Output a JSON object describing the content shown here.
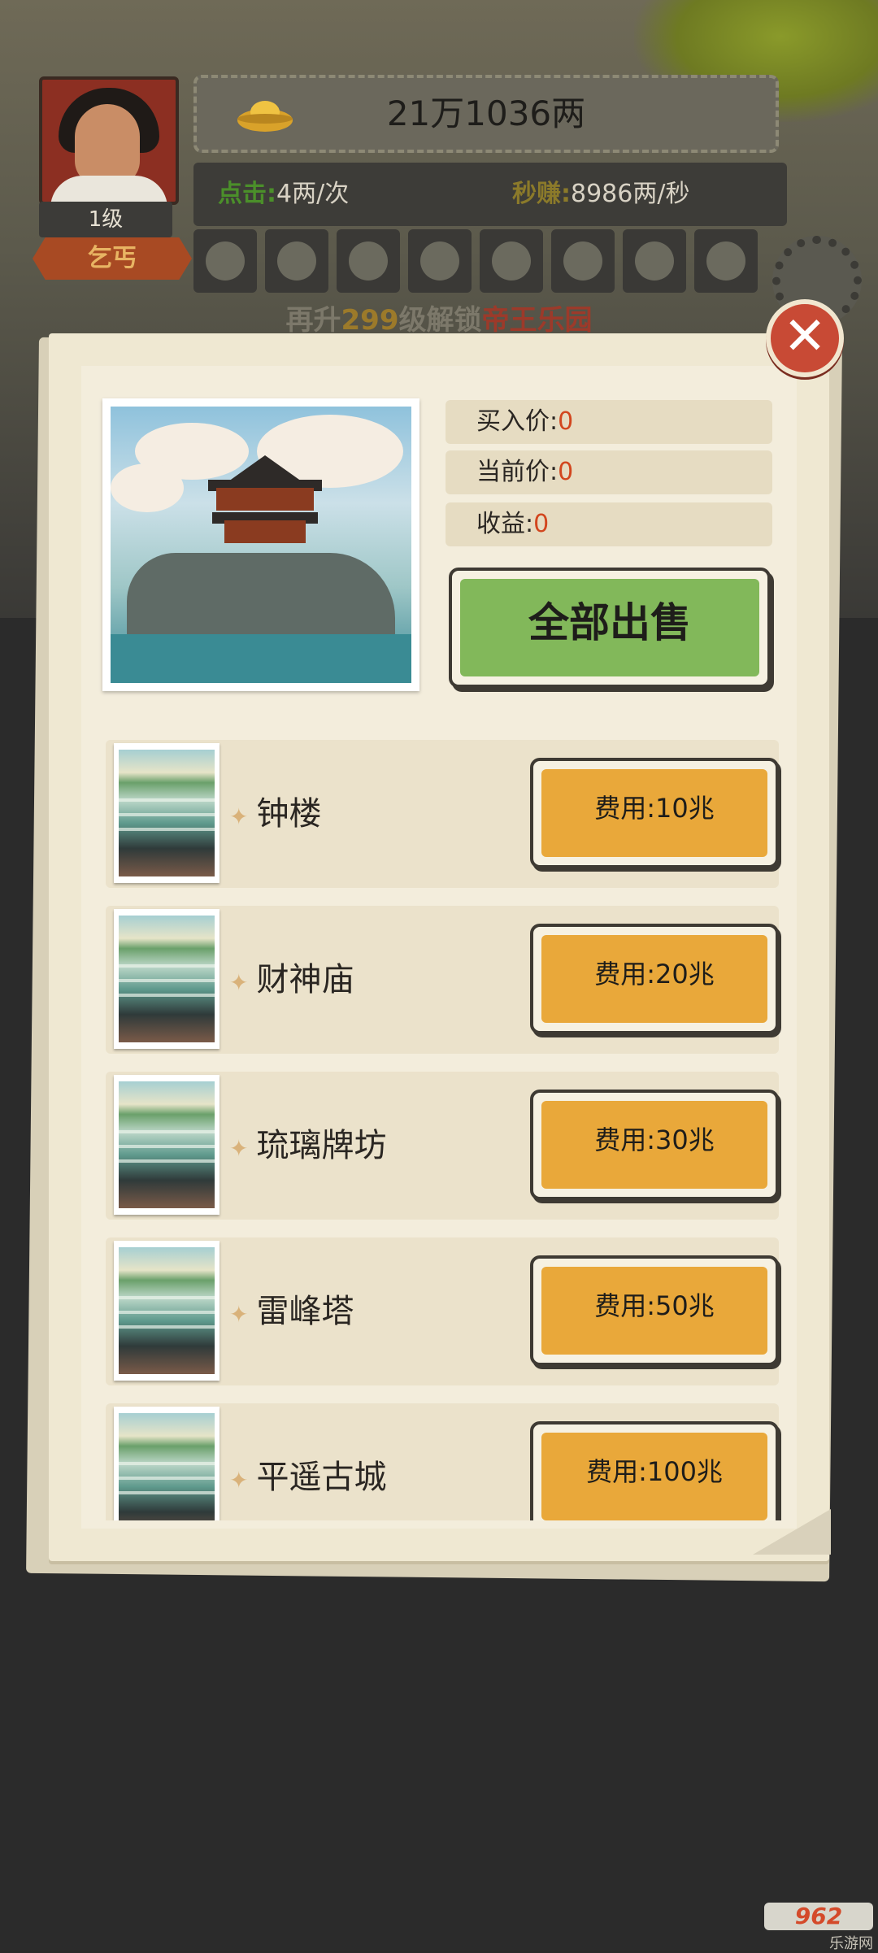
{
  "header": {
    "level": "1级",
    "rank_title": "乞丐",
    "money": "21万1036两",
    "click_label": "点击:",
    "click_value": "4两/次",
    "sec_label": "秒赚:",
    "sec_value": "8986两/秒",
    "unlock": {
      "prefix": "再升",
      "levels": "299",
      "middle": "级解锁",
      "target": "帝王乐园"
    },
    "item_icons": [
      "vase-icon",
      "gold-ingot-icon",
      "lotus-icon",
      "umbrella-icon",
      "book-icon",
      "plant-icon",
      "sword-icon",
      "flower-icon"
    ]
  },
  "panel": {
    "close_symbol": "✕",
    "buy_price_label": "买入价:",
    "buy_price_value": "0",
    "current_price_label": "当前价:",
    "current_price_value": "0",
    "profit_label": "收益:",
    "profit_value": "0",
    "sell_all_label": "全部出售",
    "items": [
      {
        "name": "钟楼",
        "cost": "费用:10兆"
      },
      {
        "name": "财神庙",
        "cost": "费用:20兆"
      },
      {
        "name": "琉璃牌坊",
        "cost": "费用:30兆"
      },
      {
        "name": "雷峰塔",
        "cost": "费用:50兆"
      },
      {
        "name": "平遥古城",
        "cost": "费用:100兆"
      }
    ],
    "diamond": "✦"
  },
  "watermark": {
    "logo": "962",
    "site": "乐游网"
  },
  "colors": {
    "accent_red": "#d2461e",
    "button_orange": "#e9a83a",
    "button_green": "#82b85a"
  }
}
